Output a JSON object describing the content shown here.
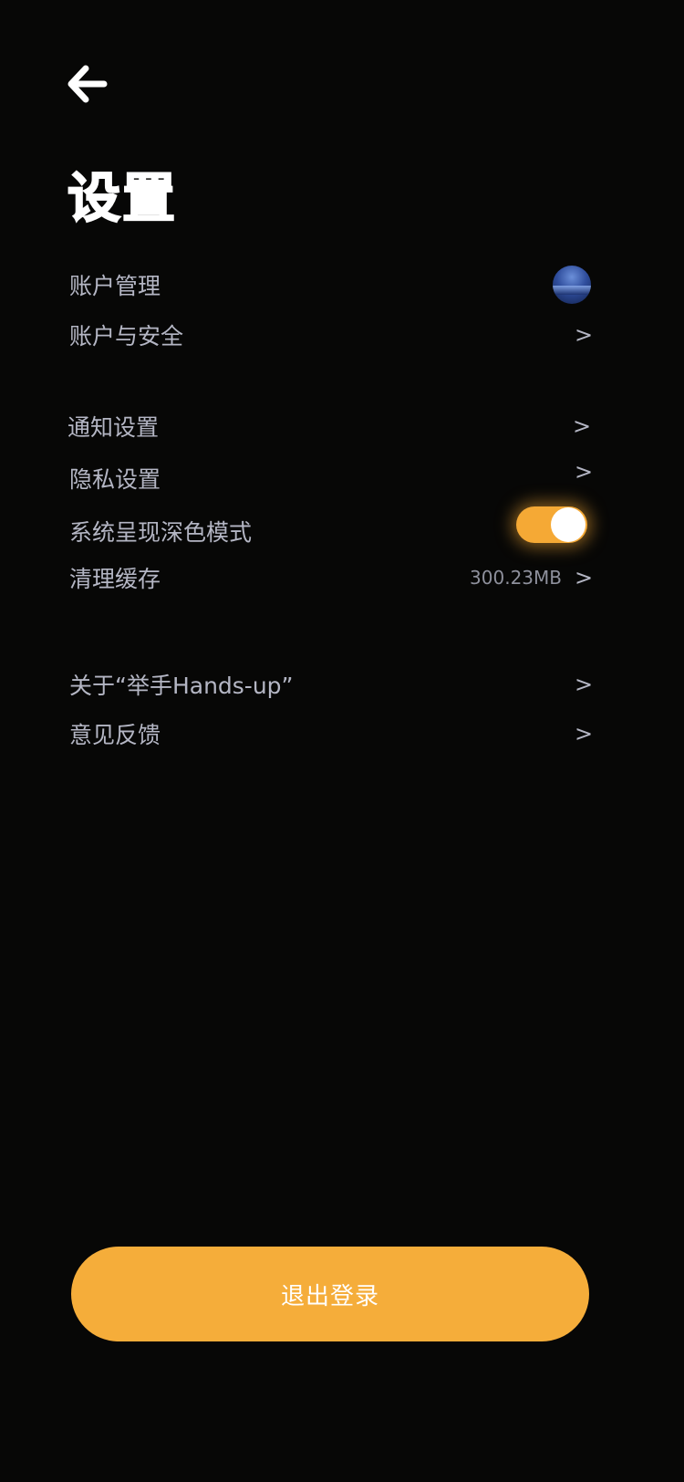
{
  "header": {
    "back_icon": "arrow-left-icon",
    "title": "设置"
  },
  "section_account": {
    "account_management": {
      "label": "账户管理",
      "avatar_icon": "avatar-image"
    },
    "account_security": {
      "label": "账户与安全",
      "chevron": ">"
    }
  },
  "section_general": {
    "notification": {
      "label": "通知设置",
      "chevron": ">"
    },
    "privacy": {
      "label": "隐私设置",
      "chevron": ">"
    },
    "dark_mode": {
      "label": "系统呈现深色模式",
      "enabled": true
    },
    "clear_cache": {
      "label": "清理缓存",
      "size": "300.23MB",
      "chevron": ">"
    }
  },
  "section_about": {
    "about": {
      "label": "关于“举手Hands-up”",
      "chevron": ">"
    },
    "feedback": {
      "label": "意见反馈",
      "chevron": ">"
    }
  },
  "footer": {
    "logout_label": "退出登录"
  },
  "colors": {
    "background": "#070706",
    "accent": "#f5ad3a",
    "text_secondary": "#b4b6c4"
  }
}
